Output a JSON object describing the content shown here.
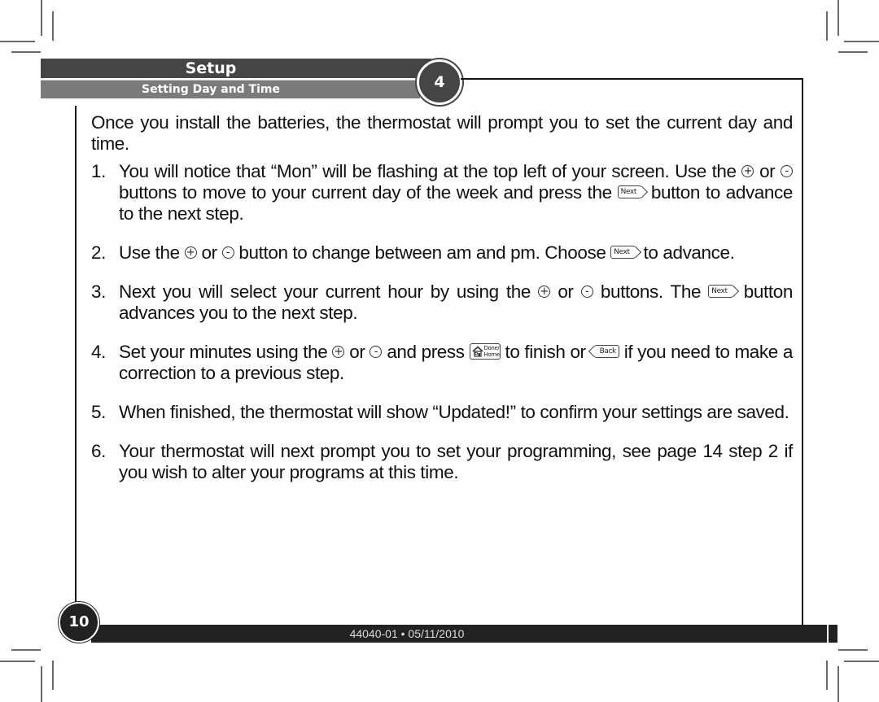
{
  "header": {
    "section_title": "Setup",
    "subsection_title": "Setting Day and Time",
    "step_number": "4"
  },
  "content": {
    "intro": "Once you install the batteries, the thermostat will prompt you to set the current day and time.",
    "icons": {
      "plus": "+",
      "minus": "-",
      "next": "Next",
      "back": "Back",
      "done_home_line1": "Done/",
      "done_home_line2": "Home"
    },
    "steps": [
      {
        "num": "1.",
        "parts": [
          "You will notice that “Mon” will be flashing at the top left of your screen. Use the",
          "or",
          "buttons to move to your current day of the week and press the",
          "button to advance to the next step."
        ]
      },
      {
        "num": "2.",
        "parts": [
          "Use the",
          "or",
          "button to change between am and pm. Choose",
          "to advance."
        ]
      },
      {
        "num": "3.",
        "parts": [
          "Next you will select your current hour by using the",
          "or",
          "buttons. The",
          "button advances you to the next step."
        ]
      },
      {
        "num": "4.",
        "parts": [
          "Set your minutes using the",
          "or",
          "and press",
          "to finish or",
          "if you need to make a correction to a previous step."
        ]
      },
      {
        "num": "5.",
        "parts": [
          "When finished, the thermostat will show “Updated!” to confirm your settings are saved."
        ]
      },
      {
        "num": "6.",
        "parts": [
          "Your thermostat will next prompt you to set your programming, see page 14 step 2 if you wish to alter your programs at this time."
        ]
      }
    ]
  },
  "footer": {
    "page_number": "10",
    "doc_code": "44040-01 • 05/11/2010"
  }
}
